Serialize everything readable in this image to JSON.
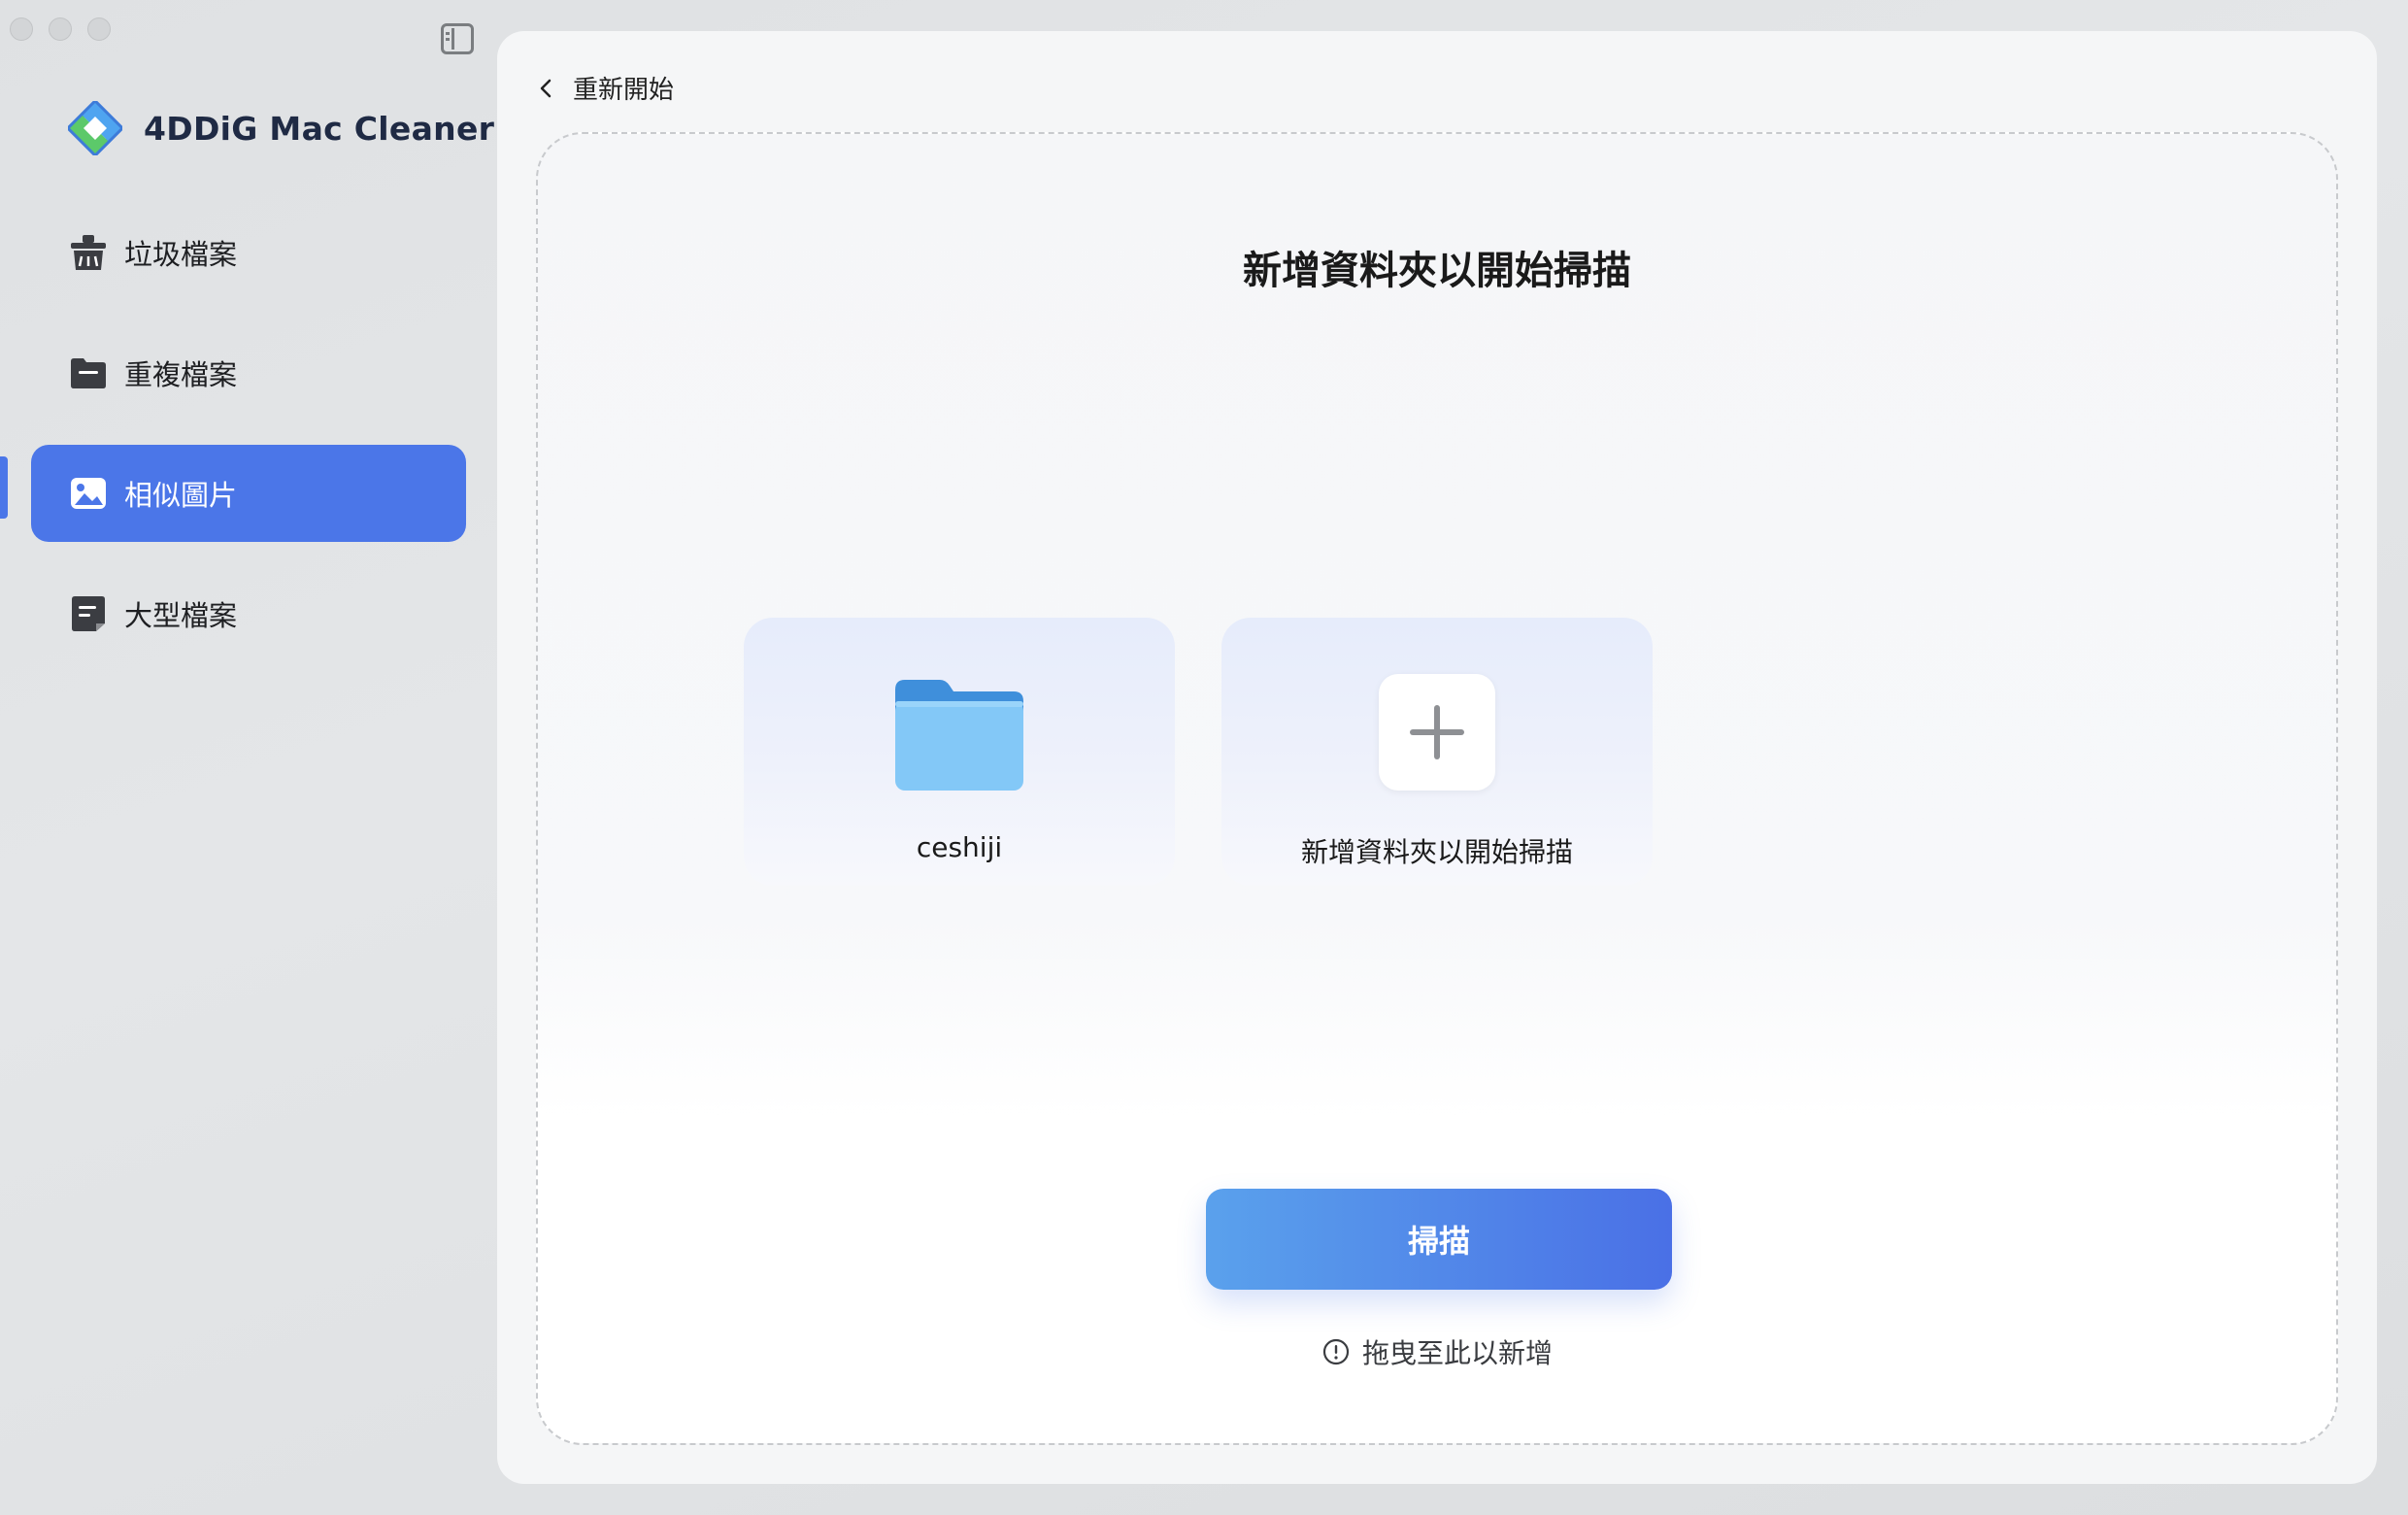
{
  "app": {
    "name": "4DDiG Mac Cleaner"
  },
  "sidebar": {
    "items": [
      {
        "label": "垃圾檔案",
        "icon": "trash-broom-icon",
        "active": false
      },
      {
        "label": "重複檔案",
        "icon": "folder-icon",
        "active": false
      },
      {
        "label": "相似圖片",
        "icon": "image-icon",
        "active": true
      },
      {
        "label": "大型檔案",
        "icon": "document-icon",
        "active": false
      }
    ]
  },
  "main": {
    "back_label": "重新開始",
    "dropzone_title": "新增資料夾以開始掃描",
    "cards": [
      {
        "label": "ceshiji",
        "icon": "folder-icon"
      },
      {
        "label": "新增資料夾以開始掃描",
        "icon": "plus-icon"
      }
    ],
    "scan_button": "掃描",
    "hint": "拖曳至此以新增"
  },
  "colors": {
    "accent": "#4b76e8",
    "scan_gradient_start": "#5aa1ec",
    "scan_gradient_end": "#4a70e6",
    "background": "#f5f6f7"
  }
}
